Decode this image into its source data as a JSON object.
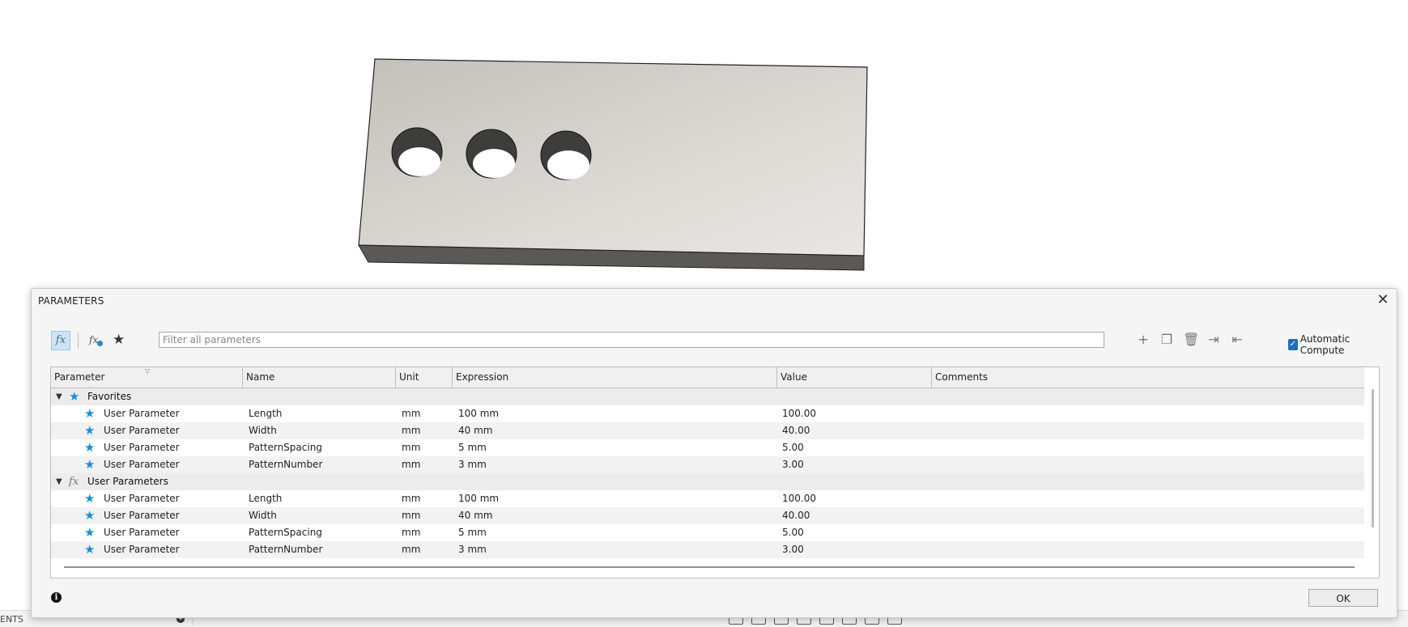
{
  "browser": {
    "label": "ENTS"
  },
  "dialog": {
    "title": "PARAMETERS",
    "filter_placeholder": "Filter all parameters",
    "auto_compute_label": "Automatic Compute",
    "auto_compute_checked": true,
    "ok_label": "OK",
    "columns": [
      "Parameter",
      "Name",
      "Unit",
      "Expression",
      "Value",
      "Comments"
    ],
    "groups": [
      {
        "label": "Favorites",
        "icon": "star-icon",
        "rows": [
          {
            "parameter": "User Parameter",
            "name": "Length",
            "unit": "mm",
            "expression": "100 mm",
            "value": "100.00",
            "comments": ""
          },
          {
            "parameter": "User Parameter",
            "name": "Width",
            "unit": "mm",
            "expression": "40 mm",
            "value": "40.00",
            "comments": ""
          },
          {
            "parameter": "User Parameter",
            "name": "PatternSpacing",
            "unit": "mm",
            "expression": "5 mm",
            "value": "5.00",
            "comments": ""
          },
          {
            "parameter": "User Parameter",
            "name": "PatternNumber",
            "unit": "mm",
            "expression": "3 mm",
            "value": "3.00",
            "comments": ""
          }
        ]
      },
      {
        "label": "User Parameters",
        "icon": "fx-icon",
        "rows": [
          {
            "parameter": "User Parameter",
            "name": "Length",
            "unit": "mm",
            "expression": "100 mm",
            "value": "100.00",
            "comments": ""
          },
          {
            "parameter": "User Parameter",
            "name": "Width",
            "unit": "mm",
            "expression": "40 mm",
            "value": "40.00",
            "comments": ""
          },
          {
            "parameter": "User Parameter",
            "name": "PatternSpacing",
            "unit": "mm",
            "expression": "5 mm",
            "value": "5.00",
            "comments": ""
          },
          {
            "parameter": "User Parameter",
            "name": "PatternNumber",
            "unit": "mm",
            "expression": "3 mm",
            "value": "3.00",
            "comments": ""
          }
        ]
      }
    ]
  },
  "colors": {
    "accent_blue": "#1a8fd1",
    "model_face": "#d2cfca",
    "model_side": "#5a5955"
  }
}
